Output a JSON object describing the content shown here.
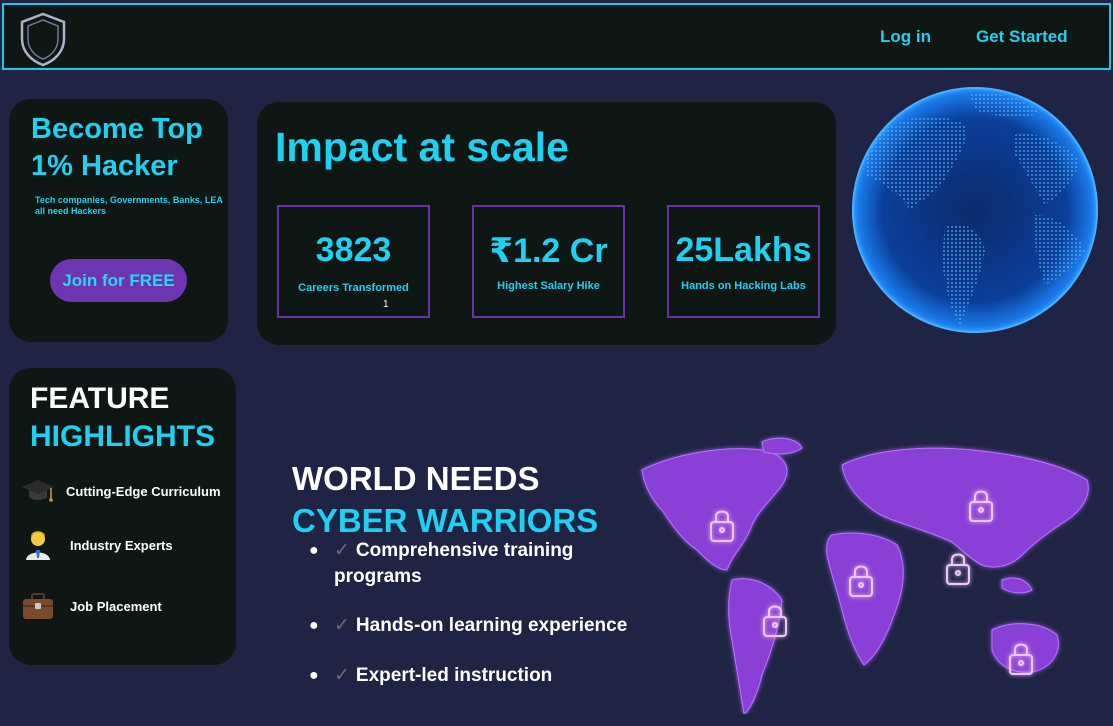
{
  "nav": {
    "login": "Log in",
    "get_started": "Get Started"
  },
  "hero": {
    "title": "Become Top 1% Hacker",
    "subtitle": "Tech companies, Governments, Banks, LEA all need Hackers",
    "cta": "Join for FREE"
  },
  "impact": {
    "title": "Impact at scale",
    "stats": [
      {
        "value": "3823",
        "label": "Careers Transformed",
        "extra": "1"
      },
      {
        "value": "₹1.2 Cr",
        "label": "Highest Salary Hike"
      },
      {
        "value": "25Lakhs",
        "label": "Hands on Hacking Labs"
      }
    ]
  },
  "features": {
    "title_line1": "FEATURE",
    "title_line2": "HIGHLIGHTS",
    "items": [
      {
        "label": "Cutting-Edge Curriculum",
        "icon": "graduation-cap-icon"
      },
      {
        "label": "Industry Experts",
        "icon": "expert-person-icon"
      },
      {
        "label": "Job Placement",
        "icon": "briefcase-icon"
      }
    ]
  },
  "world": {
    "title_line1": "WORLD NEEDS",
    "title_line2": "CYBER WARRIORS",
    "bullets": [
      "Comprehensive training programs",
      "Hands-on learning experience",
      "Expert-led instruction"
    ]
  },
  "colors": {
    "background": "#1f2444",
    "card": "#0f1714",
    "accent": "#1fd0f0",
    "purple": "#6d35b0"
  }
}
